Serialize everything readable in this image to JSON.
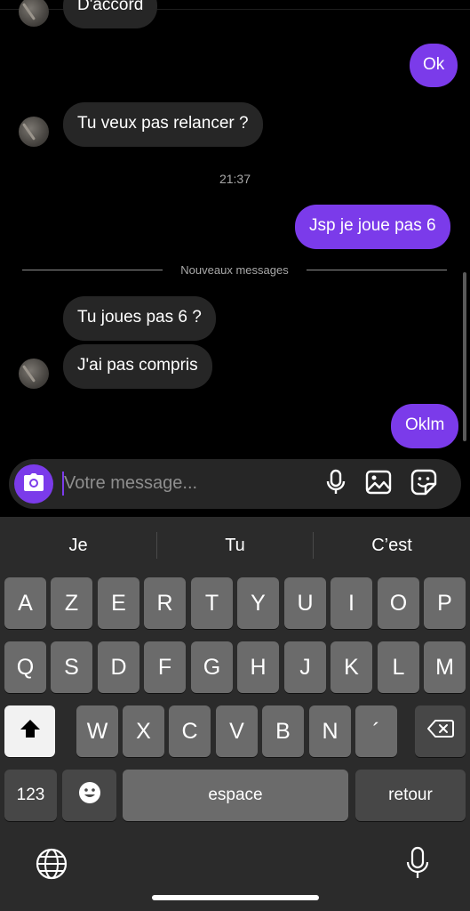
{
  "messages": {
    "top_partial": "D'accord",
    "ok": "Ok",
    "relancer": "Tu veux pas relancer  ?",
    "timestamp": "21:37",
    "jsp": "Jsp je joue pas 6",
    "new_messages": "Nouveaux messages",
    "joues": "Tu joues pas 6 ?",
    "compris": "J'ai pas compris",
    "oklm": "Oklm"
  },
  "composer": {
    "placeholder": "Votre message..."
  },
  "keyboard": {
    "suggestions": [
      "Je",
      "Tu",
      "C’est"
    ],
    "row1": [
      "A",
      "Z",
      "E",
      "R",
      "T",
      "Y",
      "U",
      "I",
      "O",
      "P"
    ],
    "row2": [
      "Q",
      "S",
      "D",
      "F",
      "G",
      "H",
      "J",
      "K",
      "L",
      "M"
    ],
    "row3": [
      "W",
      "X",
      "C",
      "V",
      "B",
      "N",
      "´"
    ],
    "numbers": "123",
    "space": "espace",
    "return": "retour"
  },
  "icons": {
    "camera": "camera-icon",
    "mic": "microphone-icon",
    "gallery": "image-gallery-icon",
    "sticker": "sticker-icon",
    "shift": "shift-icon",
    "backspace": "backspace-icon",
    "emoji": "emoji-icon",
    "globe": "globe-icon",
    "dictation": "dictation-microphone-icon"
  },
  "colors": {
    "accent": "#7B3BEA",
    "incoming_bubble": "#262626",
    "background": "#000000",
    "keyboard_bg": "#2b2b2b",
    "key": "#6b6b6b"
  }
}
